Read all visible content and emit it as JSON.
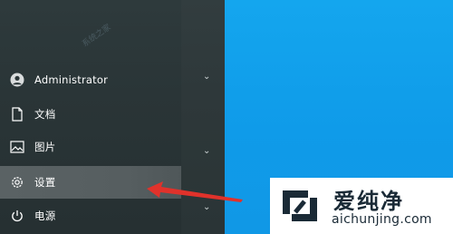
{
  "start_menu": {
    "watermark": "系统之家",
    "items": [
      {
        "label": "Administrator",
        "icon": "user-avatar-icon"
      },
      {
        "label": "文档",
        "icon": "document-icon"
      },
      {
        "label": "图片",
        "icon": "picture-icon"
      },
      {
        "label": "设置",
        "icon": "gear-icon",
        "active": true
      },
      {
        "label": "电源",
        "icon": "power-icon"
      }
    ]
  },
  "logo": {
    "chinese": "爱纯净",
    "domain": "aichunjing.com"
  },
  "colors": {
    "panel": "#2b3638",
    "active_row": "#5a6264",
    "desktop": "#14a6ee",
    "arrow": "#e0322b"
  }
}
